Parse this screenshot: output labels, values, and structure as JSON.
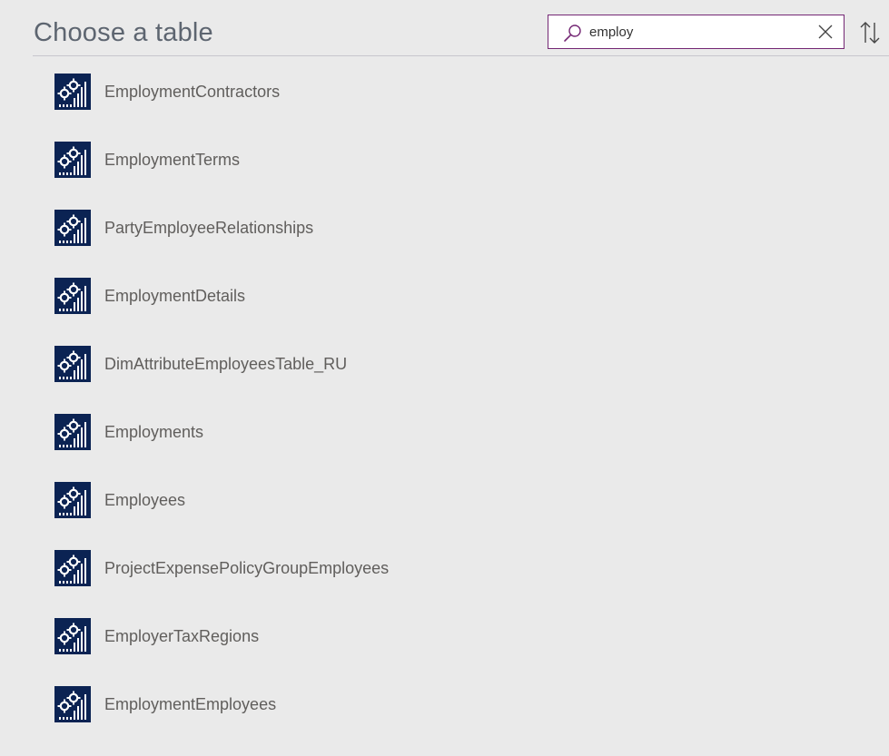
{
  "header": {
    "title": "Choose a table"
  },
  "search": {
    "value": "employ",
    "icon": "search-icon",
    "clear_icon": "close-icon"
  },
  "toolbar": {
    "sort_icon": "sort-icon"
  },
  "colors": {
    "accent": "#742774",
    "entity_icon_bg": "#0b2353",
    "background": "#eaeaea"
  },
  "tables": [
    {
      "name": "EmploymentContractors",
      "icon": "entity-table-icon"
    },
    {
      "name": "EmploymentTerms",
      "icon": "entity-table-icon"
    },
    {
      "name": "PartyEmployeeRelationships",
      "icon": "entity-table-icon"
    },
    {
      "name": "EmploymentDetails",
      "icon": "entity-table-icon"
    },
    {
      "name": "DimAttributeEmployeesTable_RU",
      "icon": "entity-table-icon"
    },
    {
      "name": "Employments",
      "icon": "entity-table-icon"
    },
    {
      "name": "Employees",
      "icon": "entity-table-icon"
    },
    {
      "name": "ProjectExpensePolicyGroupEmployees",
      "icon": "entity-table-icon"
    },
    {
      "name": "EmployerTaxRegions",
      "icon": "entity-table-icon"
    },
    {
      "name": "EmploymentEmployees",
      "icon": "entity-table-icon"
    }
  ]
}
